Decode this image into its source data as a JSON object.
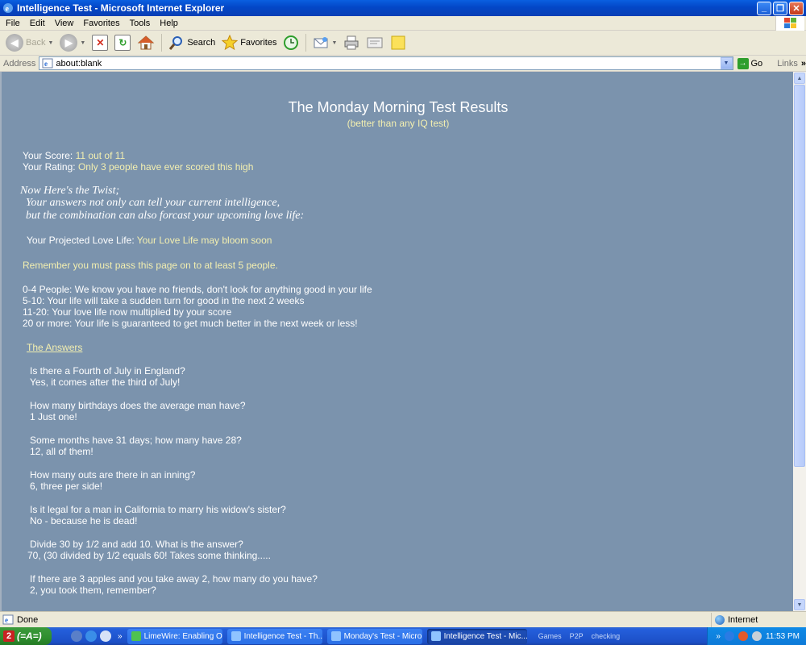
{
  "window": {
    "title": "Intelligence Test - Microsoft Internet Explorer",
    "minimize": "_",
    "maximize": "❐",
    "close": "✕"
  },
  "menu": [
    "File",
    "Edit",
    "View",
    "Favorites",
    "Tools",
    "Help"
  ],
  "toolbar": {
    "back": "Back",
    "search": "Search",
    "favorites": "Favorites"
  },
  "address": {
    "label": "Address",
    "value": "about:blank",
    "go": "Go",
    "links": "Links"
  },
  "page": {
    "title": "The Monday Morning Test Results",
    "subtitle": "(better than any IQ test)",
    "score_label": "Your Score: ",
    "score_value": "11 out of 11",
    "rating_label": "Your Rating: ",
    "rating_value": "Only 3 people have ever scored this high",
    "twist": [
      "Now Here's the Twist;",
      "  Your answers not only can tell your current intelligence,",
      "  but the combination can also forcast your upcoming love life:"
    ],
    "love_label": "Your Projected Love Life: ",
    "love_value": "Your Love Life may bloom soon",
    "remember": "Remember you must pass this page on to at least 5 people.",
    "tiers": [
      "0-4 People: We know you have no friends, don't look for anything good in your life",
      "5-10: Your life will take a sudden turn for good in the next 2 weeks",
      "11-20: Your love life now multiplied by your score",
      "20 or more: Your life is guaranteed to get much better in the next week or less!"
    ],
    "answers_link": "The Answers",
    "qa": [
      {
        "q": "Is there a Fourth of July in England?",
        "a": "Yes, it comes after the third of July!"
      },
      {
        "q": "How many birthdays does the average man have?",
        "a": "1 Just one!"
      },
      {
        "q": "Some months have 31 days; how many have 28?",
        "a": "12, all of them!"
      },
      {
        "q": "How many outs are there in an inning?",
        "a": "6, three per side!"
      },
      {
        "q": "Is it legal for a man in California to marry his widow's sister?",
        "a": "No - because he is dead!"
      },
      {
        "q": "Divide 30 by 1/2 and add 10. What is the answer?",
        "a": "70, (30  divided by 1/2 equals 60! Takes some thinking....."
      },
      {
        "q": "If there are 3 apples and you take away 2, how many do you have?",
        "a": "2, you took them, remember?"
      }
    ]
  },
  "status": {
    "text": "Done",
    "zone": "Internet"
  },
  "taskbar": {
    "start": "(=A=)",
    "start_badge": "2",
    "tasks": [
      "LimeWire: Enabling O...",
      "Intelligence Test - Th...",
      "Monday's Test - Micro...",
      "Intelligence Test - Mic..."
    ],
    "tray_labels": [
      "Games",
      "P2P",
      "checking"
    ],
    "chevron": "»",
    "clock": "11:53 PM"
  }
}
